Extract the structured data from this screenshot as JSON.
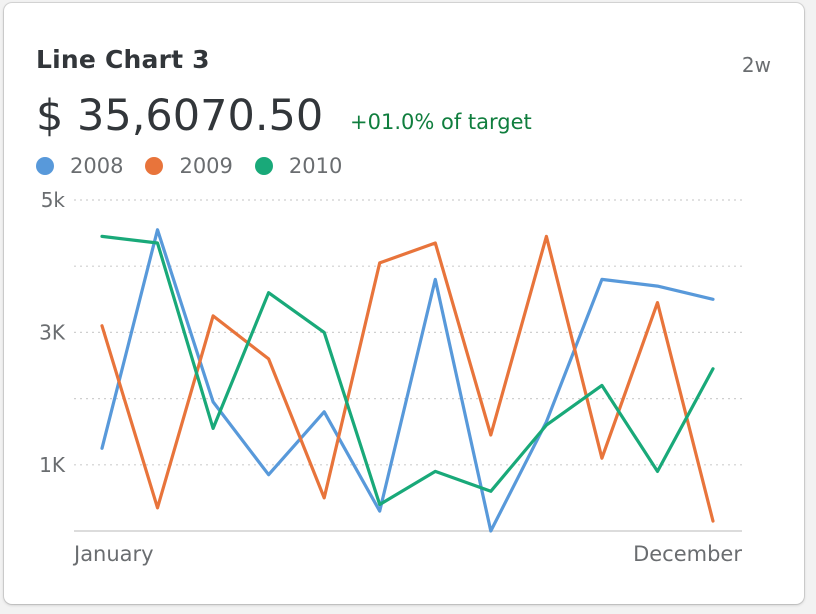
{
  "card": {
    "title": "Line Chart 3",
    "period": "2w",
    "kpi_value": "$ 35,6070.50",
    "kpi_delta": "+01.0% of target"
  },
  "colors": {
    "series_2008": "#5899da",
    "series_2009": "#e8743b",
    "series_2010": "#19a979",
    "delta_positive": "#107e3e",
    "grid": "#cfcfcf",
    "axis": "#d0d0d0",
    "label": "#6a6d70"
  },
  "chart_data": {
    "type": "line",
    "title": "Line Chart 3",
    "xlabel": "",
    "ylabel": "",
    "x_tick_labels": [
      "January",
      "December"
    ],
    "y_ticks": [
      {
        "value": 5000,
        "label": "5k"
      },
      {
        "value": 3000,
        "label": "3K"
      },
      {
        "value": 1000,
        "label": "1K"
      }
    ],
    "ylim": [
      0,
      5000
    ],
    "grid": true,
    "legend_position": "top-left",
    "series": [
      {
        "name": "2008",
        "values": [
          1250,
          4550,
          1950,
          850,
          1800,
          300,
          3800,
          0,
          1650,
          3800,
          3700,
          3500
        ]
      },
      {
        "name": "2009",
        "values": [
          3100,
          350,
          3250,
          2600,
          500,
          4050,
          4350,
          1450,
          4450,
          1100,
          3450,
          150
        ]
      },
      {
        "name": "2010",
        "values": [
          4450,
          4350,
          1550,
          3600,
          3000,
          400,
          900,
          600,
          1600,
          2200,
          900,
          2450
        ]
      }
    ]
  }
}
